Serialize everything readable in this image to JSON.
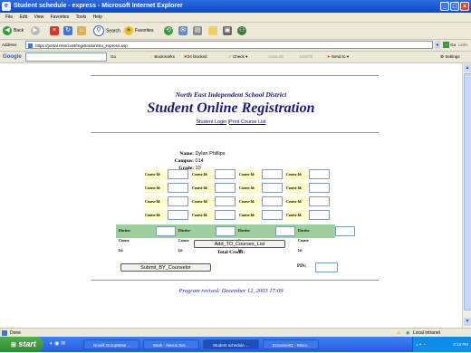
{
  "window": {
    "title": "Student schedule - express - Microsoft Internet Explorer"
  },
  "menu": [
    "File",
    "Edit",
    "View",
    "Favorites",
    "Tools",
    "Help"
  ],
  "toolbar": {
    "back": "Back",
    "search": "Search",
    "favorites": "Favorites"
  },
  "address": {
    "label": "Address",
    "url": "https://portal.neisd.net/registration/stu_express.asp",
    "go": "Go",
    "links": "Links"
  },
  "googlebar": {
    "logo": "Google",
    "go": "Go",
    "bookmarks": "Bookmarks",
    "blocked": "24 blocked",
    "check": "Check",
    "autolink": "AutoLink",
    "autofill": "AutoFill",
    "sendto": "Send to",
    "settings": "Settings"
  },
  "page": {
    "district": "North East Independent School District",
    "title": "Student Online Registration",
    "link_login": "Student Login",
    "link_separator": "|",
    "link_print": "Print Course List",
    "name_label": "Name:",
    "name_value": "Dylan Phillips",
    "campus_label": "Campus:",
    "campus_value": "014",
    "grade_label": "Grade:",
    "grade_value": "10",
    "course_label": "Course Id:",
    "elective_label": "Elective Course Id:",
    "add_button": "Add_TO_Courses_List",
    "total_credit": "Total Credit:",
    "submit_button": "Submit_BY_Counselor",
    "pin_label": "PIN:",
    "revised": "Program revised: December 12, 2003 17:09"
  },
  "status": {
    "left": "Done",
    "zone": "Local intranet"
  },
  "taskbar": {
    "start": "start",
    "tasks": [
      "Novell GroupWise ...",
      "Work - Nexus Ser...",
      "Student schedule ...",
      "Document1 - Micro..."
    ],
    "clock": "4:13 PM"
  }
}
